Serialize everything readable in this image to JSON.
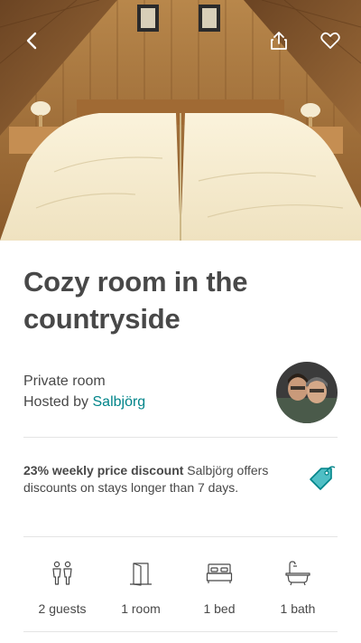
{
  "listing": {
    "title": "Cozy room in the countryside",
    "room_type": "Private room",
    "hosted_by_prefix": "Hosted by",
    "host_name": "Salbjörg"
  },
  "discount": {
    "headline": "23% weekly price discount",
    "description": "Salbjörg offers discounts on stays longer than 7 days."
  },
  "amenities": [
    {
      "icon": "guests-icon",
      "label": "2 guests"
    },
    {
      "icon": "door-icon",
      "label": "1 room"
    },
    {
      "icon": "bed-icon",
      "label": "1 bed"
    },
    {
      "icon": "bath-icon",
      "label": "1 bath"
    }
  ],
  "colors": {
    "text": "#484848",
    "accent_teal": "#008489",
    "divider": "#e4e4e4"
  }
}
